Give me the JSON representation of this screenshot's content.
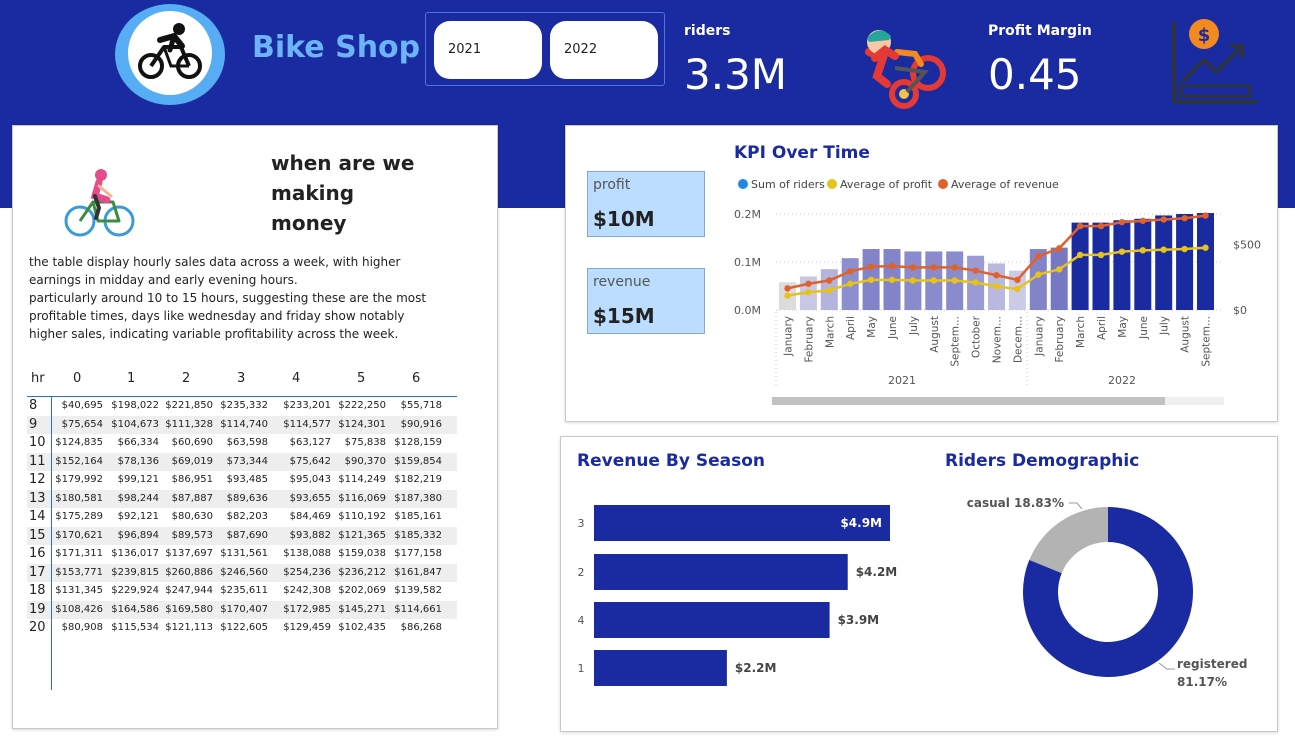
{
  "header": {
    "app_title": "Bike Shop",
    "year_buttons": [
      "2021",
      "2022"
    ],
    "riders_label": "riders",
    "riders_value": "3.3M",
    "margin_label": "Profit Margin",
    "margin_value": "0.45",
    "band_color": "#1a2aa0",
    "title_color": "#6cb4f7",
    "logo_icon": "bicycle-rider-icon",
    "art_icon": "cartoon-rider-icon",
    "growth_icon": "dollar-growth-chart-icon"
  },
  "left_panel": {
    "heading": [
      "when are we",
      "making",
      "money"
    ],
    "description": [
      "the table display hourly sales data across a week, with higher earnings in midday and early evening hours.",
      "particularly around 10 to 15 hours, suggesting these are the most profitable times, days like wednesday and friday show notably higher sales, indicating variable profitability across the week."
    ],
    "cyclist_icon": "cyclist-woman-icon"
  },
  "kpi_cards": {
    "profit_label": "profit",
    "profit_value": "$10M",
    "revenue_label": "revenue",
    "revenue_value": "$15M",
    "card_color": "#bbddff"
  },
  "chart_data": [
    {
      "type": "table",
      "row_header": "hr",
      "columns": [
        "0",
        "1",
        "2",
        "3",
        "4",
        "5",
        "6"
      ],
      "rows": [
        {
          "hr": "8",
          "values": [
            "$40,695",
            "$198,022",
            "$221,850",
            "$235,332",
            "$233,201",
            "$222,250",
            "$55,718"
          ]
        },
        {
          "hr": "9",
          "values": [
            "$75,654",
            "$104,673",
            "$111,328",
            "$114,740",
            "$114,577",
            "$124,301",
            "$90,916"
          ]
        },
        {
          "hr": "10",
          "values": [
            "$124,835",
            "$66,334",
            "$60,690",
            "$63,598",
            "$63,127",
            "$75,838",
            "$128,159"
          ]
        },
        {
          "hr": "11",
          "values": [
            "$152,164",
            "$78,136",
            "$69,019",
            "$73,344",
            "$75,642",
            "$90,370",
            "$159,854"
          ]
        },
        {
          "hr": "12",
          "values": [
            "$179,992",
            "$99,121",
            "$86,951",
            "$93,485",
            "$95,043",
            "$114,249",
            "$182,219"
          ]
        },
        {
          "hr": "13",
          "values": [
            "$180,581",
            "$98,244",
            "$87,887",
            "$89,636",
            "$93,655",
            "$116,069",
            "$187,380"
          ]
        },
        {
          "hr": "14",
          "values": [
            "$175,289",
            "$92,121",
            "$80,630",
            "$82,203",
            "$84,469",
            "$110,192",
            "$185,161"
          ]
        },
        {
          "hr": "15",
          "values": [
            "$170,621",
            "$96,894",
            "$89,573",
            "$87,690",
            "$93,882",
            "$121,365",
            "$185,332"
          ]
        },
        {
          "hr": "16",
          "values": [
            "$171,311",
            "$136,017",
            "$137,697",
            "$131,561",
            "$138,088",
            "$159,038",
            "$177,158"
          ]
        },
        {
          "hr": "17",
          "values": [
            "$153,771",
            "$239,815",
            "$260,886",
            "$246,560",
            "$254,236",
            "$236,212",
            "$161,847"
          ]
        },
        {
          "hr": "18",
          "values": [
            "$131,345",
            "$229,924",
            "$247,944",
            "$235,611",
            "$242,308",
            "$202,069",
            "$139,582"
          ]
        },
        {
          "hr": "19",
          "values": [
            "$108,426",
            "$164,586",
            "$169,580",
            "$170,407",
            "$172,985",
            "$145,271",
            "$114,661"
          ]
        },
        {
          "hr": "20",
          "values": [
            "$80,908",
            "$115,534",
            "$121,113",
            "$122,605",
            "$129,459",
            "$102,435",
            "$86,268"
          ]
        }
      ]
    },
    {
      "type": "bar",
      "title": "KPI Over Time",
      "legend": [
        "Sum of riders",
        "Average of profit",
        "Average of revenue"
      ],
      "legend_colors": [
        "#1e88e5",
        "#e6c21c",
        "#e0622b"
      ],
      "legend_position": "top-left",
      "months": [
        "January",
        "February",
        "March",
        "April",
        "May",
        "June",
        "July",
        "August",
        "Septem...",
        "October",
        "Novem...",
        "Decem...",
        "January",
        "February",
        "March",
        "April",
        "May",
        "June",
        "July",
        "August",
        "Septem..."
      ],
      "years": [
        "2021",
        "2022"
      ],
      "y_ticks_left": [
        "0.0M",
        "0.1M",
        "0.2M"
      ],
      "y_ticks_right": [
        "$0",
        "$500"
      ],
      "ylim_left": [
        0,
        0.2
      ],
      "riders": [
        0.058,
        0.07,
        0.085,
        0.108,
        0.127,
        0.127,
        0.122,
        0.122,
        0.122,
        0.113,
        0.097,
        0.082,
        0.127,
        0.13,
        0.182,
        0.182,
        0.187,
        0.19,
        0.197,
        0.2,
        0.202
      ],
      "avg_profit": [
        110,
        135,
        150,
        200,
        230,
        230,
        225,
        225,
        225,
        210,
        180,
        160,
        270,
        310,
        420,
        420,
        445,
        455,
        460,
        465,
        475
      ],
      "avg_revenue": [
        165,
        200,
        225,
        295,
        330,
        335,
        325,
        325,
        325,
        300,
        265,
        230,
        410,
        470,
        640,
        640,
        670,
        680,
        690,
        700,
        720
      ],
      "bar_colors": {
        "2021": [
          "#dcdcdc",
          "#c8c8e4",
          "#b3b3dc",
          "#8d8ed0",
          "#8283c9",
          "#8283c9",
          "#8a8bcc",
          "#8a8bcc",
          "#8a8bcc",
          "#9a9bd4",
          "#b9b9e0",
          "#cbcbe8"
        ],
        "2022": "#1a2aa0",
        "2022_start": [
          "#8283c9",
          "#7678c3"
        ]
      }
    },
    {
      "type": "bar",
      "orientation": "horizontal",
      "title": "Revenue By Season",
      "categories": [
        "3",
        "2",
        "4",
        "1"
      ],
      "values": [
        4.9,
        4.2,
        3.9,
        2.2
      ],
      "value_labels": [
        "$4.9M",
        "$4.2M",
        "$3.9M",
        "$2.2M"
      ],
      "color": "#1a2aa0"
    },
    {
      "type": "pie",
      "title": "Riders Demographic",
      "labels": [
        "casual 18.83%",
        "registered",
        "81.17%"
      ],
      "slices": [
        {
          "name": "casual",
          "percent": 18.83,
          "color": "#b3b3b3"
        },
        {
          "name": "registered",
          "percent": 81.17,
          "color": "#1a2aa0"
        }
      ]
    }
  ]
}
